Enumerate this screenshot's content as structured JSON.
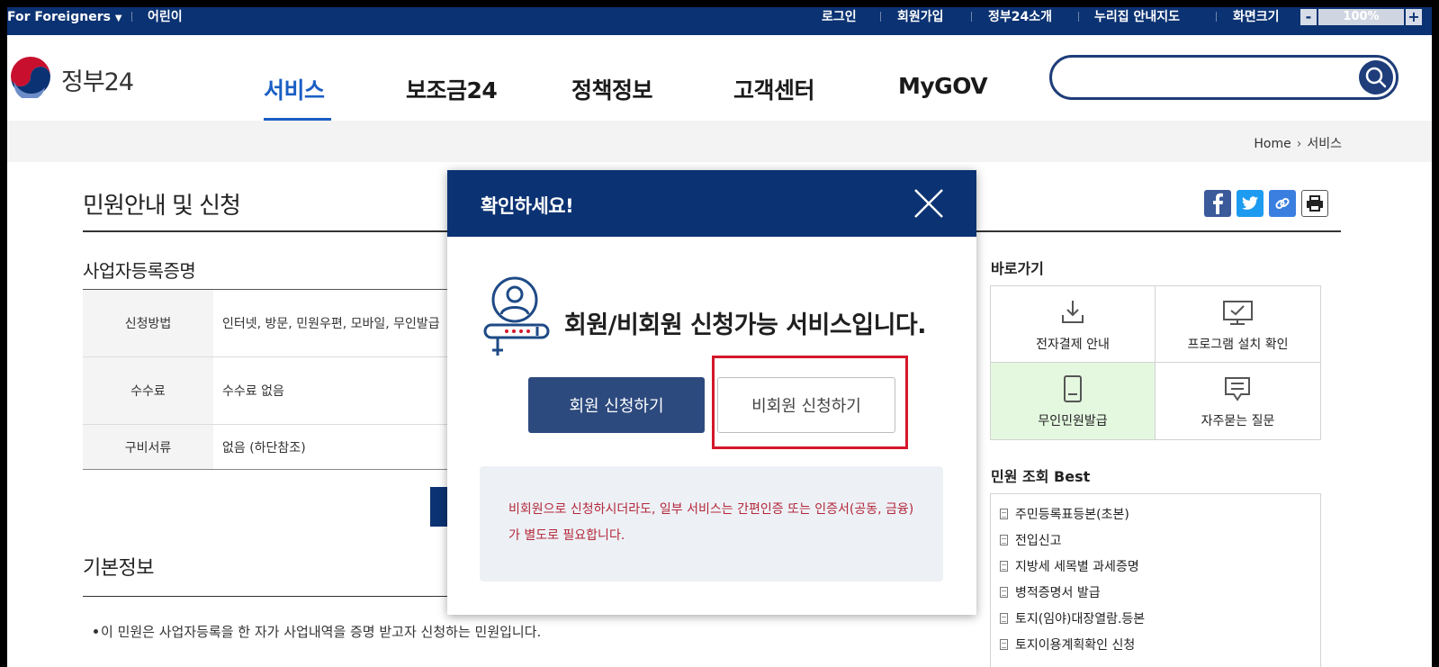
{
  "topbar": {
    "foreigners": "For Foreigners",
    "kids": "어린이",
    "links": [
      "로그인",
      "회원가입",
      "정부24소개",
      "누리집 안내지도",
      "화면크기"
    ],
    "zoom_minus": "-",
    "zoom_value": "100%",
    "zoom_plus": "+"
  },
  "header": {
    "logo_text": "정부24",
    "nav": [
      "서비스",
      "보조금24",
      "정책정보",
      "고객센터",
      "MyGOV"
    ],
    "active_nav": "서비스",
    "search_placeholder": ""
  },
  "breadcrumb": {
    "home": "Home",
    "current": "서비스"
  },
  "main": {
    "page_title": "민원안내 및 신청",
    "section_title": "사업자등록증명",
    "rows": [
      {
        "label": "신청방법",
        "value": "인터넷, 방문, 민원우편, 모바일, 무인발급"
      },
      {
        "label": "수수료",
        "value": "수수료 없음"
      },
      {
        "label": "구비서류",
        "value": "없음 (하단참조)"
      }
    ],
    "basic_info_title": "기본정보",
    "basic_info_bullet": "이 민원은 사업자등록을 한 자가 사업내역을 증명 받고자 신청하는 민원입니다."
  },
  "sidebar": {
    "quick_title": "바로가기",
    "quick_items": [
      "전자결제 안내",
      "프로그램 설치 확인",
      "무인민원발급",
      "자주묻는 질문"
    ],
    "best_title": "민원 조회 Best",
    "best_items": [
      "주민등록표등본(초본)",
      "전입신고",
      "지방세 세목별 과세증명",
      "병적증명서 발급",
      "토지(임야)대장열람.등본",
      "토지이용계획확인 신청"
    ]
  },
  "modal": {
    "title": "확인하세요!",
    "message": "회원/비회원 신청가능 서비스입니다.",
    "member_button": "회원 신청하기",
    "guest_button": "비회원 신청하기",
    "notice": "비회원으로 신청하시더라도, 일부 서비스는 간편인증 또는 인증서(공동, 금융)가 별도로 필요합니다."
  },
  "colors": {
    "topbar": "#0b3272",
    "accent": "#1a5ec4",
    "member_button": "#2d4a7e",
    "highlight": "#d5172b",
    "notice_text": "#b4283a",
    "quick_highlight_bg": "#e4f8e0"
  },
  "icons": [
    "caret-down-icon",
    "search-icon",
    "home-arrow-icon",
    "facebook-icon",
    "twitter-icon",
    "link-icon",
    "print-icon",
    "close-icon",
    "user-login-icon",
    "download-icon",
    "monitor-check-icon",
    "kiosk-icon",
    "chat-icon",
    "document-icon"
  ]
}
